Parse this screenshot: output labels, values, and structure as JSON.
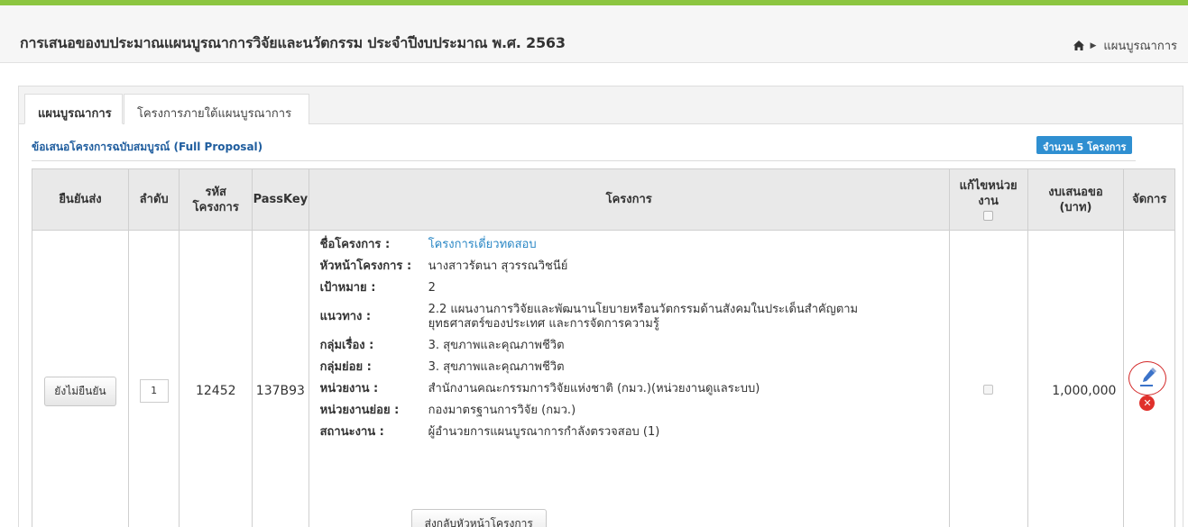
{
  "header": {
    "title": "การเสนอของบประมาณแผนบูรณาการวิจัยและนวัตกรรม ประจำปีงบประมาณ พ.ศ. 2563",
    "breadcrumb": "แผนบูรณาการ",
    "accent_color": "#8cc540"
  },
  "tabs": [
    {
      "label": "แผนบูรณาการ",
      "active": true
    },
    {
      "label": "โครงการภายใต้แผนบูรณาการ",
      "active": false
    }
  ],
  "section": {
    "title": "ข้อเสนอโครงการฉบับสมบูรณ์ (Full Proposal)",
    "count_badge": "จำนวน 5 โครงการ"
  },
  "table": {
    "headers": {
      "confirm": "ยืนยันส่ง",
      "order": "ลำดับ",
      "code_line1": "รหัส",
      "code_line2": "โครงการ",
      "passkey": "PassKey",
      "project": "โครงการ",
      "edit_unit_line1": "แก้ไขหน่วย",
      "edit_unit_line2": "งาน",
      "budget_line1": "งบเสนอขอ",
      "budget_line2": "(บาท)",
      "manage": "จัดการ"
    },
    "rows": [
      {
        "confirm_label": "ยังไม่ยืนยัน",
        "order": "1",
        "code": "12452",
        "passkey": "137B93",
        "budget": "1,000,000",
        "details": {
          "name_label": "ชื่อโครงการ :",
          "name_value": "โครงการเดี่ยวทดสอบ",
          "leader_label": "หัวหน้าโครงการ :",
          "leader_value": "นางสาวรัตนา สุวรรณวิชนีย์",
          "target_label": "เป้าหมาย :",
          "target_value": "2",
          "approach_label": "แนวทาง :",
          "approach_value_line1": "2.2 แผนงานการวิจัยและพัฒนานโยบายหรือนวัตกรรมด้านสังคมในประเด็นสำคัญตาม",
          "approach_value_line2": "ยุทธศาสตร์ของประเทศ และการจัดการความรู้",
          "group_label": "กลุ่มเรื่อง :",
          "group_value": "3. สุขภาพและคุณภาพชีวิต",
          "subgroup_label": "กลุ่มย่อย :",
          "subgroup_value": "3. สุขภาพและคุณภาพชีวิต",
          "unit_label": "หน่วยงาน :",
          "unit_value": "สำนักงานคณะกรรมการวิจัยแห่งชาติ (กมว.)(หน่วยงานดูแลระบบ)",
          "subunit_label": "หน่วยงานย่อย :",
          "subunit_value": "กองมาตรฐานการวิจัย (กมว.)",
          "status_label": "สถานะงาน :",
          "status_value": "ผู้อำนวยการแผนบูรณาการกำลังตรวจสอบ (1)",
          "return_button": "ส่งกลับหัวหน้าโครงการ"
        }
      }
    ]
  },
  "icons": {
    "home": "home-icon",
    "edit": "pencil-icon",
    "delete": "delete-icon"
  }
}
